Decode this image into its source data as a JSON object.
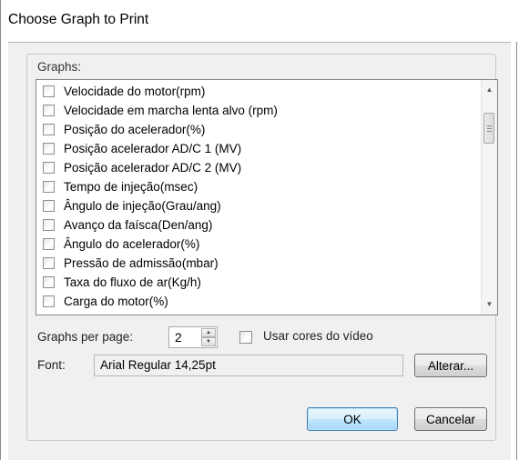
{
  "window": {
    "title": "Choose Graph to Print"
  },
  "graphs": {
    "label": "Graphs:",
    "items": [
      {
        "label": "Velocidade do motor(rpm)",
        "checked": false
      },
      {
        "label": "Velocidade em marcha lenta alvo (rpm)",
        "checked": false
      },
      {
        "label": "Posição do acelerador(%)",
        "checked": false
      },
      {
        "label": "Posição acelerador AD/C 1 (MV)",
        "checked": false
      },
      {
        "label": "Posição acelerador AD/C 2 (MV)",
        "checked": false
      },
      {
        "label": "Tempo de injeção(msec)",
        "checked": false
      },
      {
        "label": "Ângulo de injeção(Grau/ang)",
        "checked": false
      },
      {
        "label": "Avanço da faísca(Den/ang)",
        "checked": false
      },
      {
        "label": "Ângulo do acelerador(%)",
        "checked": false
      },
      {
        "label": "Pressão de admissão(mbar)",
        "checked": false
      },
      {
        "label": "Taxa do fluxo de ar(Kg/h)",
        "checked": false
      },
      {
        "label": "Carga do motor(%)",
        "checked": false
      }
    ]
  },
  "graphs_per_page": {
    "label": "Graphs per page:",
    "value": "2"
  },
  "use_video_colors": {
    "label": "Usar cores do vídeo",
    "checked": false
  },
  "font": {
    "label": "Font:",
    "value": "Arial Regular 14,25pt",
    "change_button": "Alterar..."
  },
  "buttons": {
    "ok": "OK",
    "cancel": "Cancelar"
  },
  "icons": {
    "scroll_up": "scroll-up-arrow-icon",
    "scroll_down": "scroll-down-arrow-icon"
  },
  "colors": {
    "default_button_border": "#3c7fb1",
    "background": "#f0f0f0"
  }
}
